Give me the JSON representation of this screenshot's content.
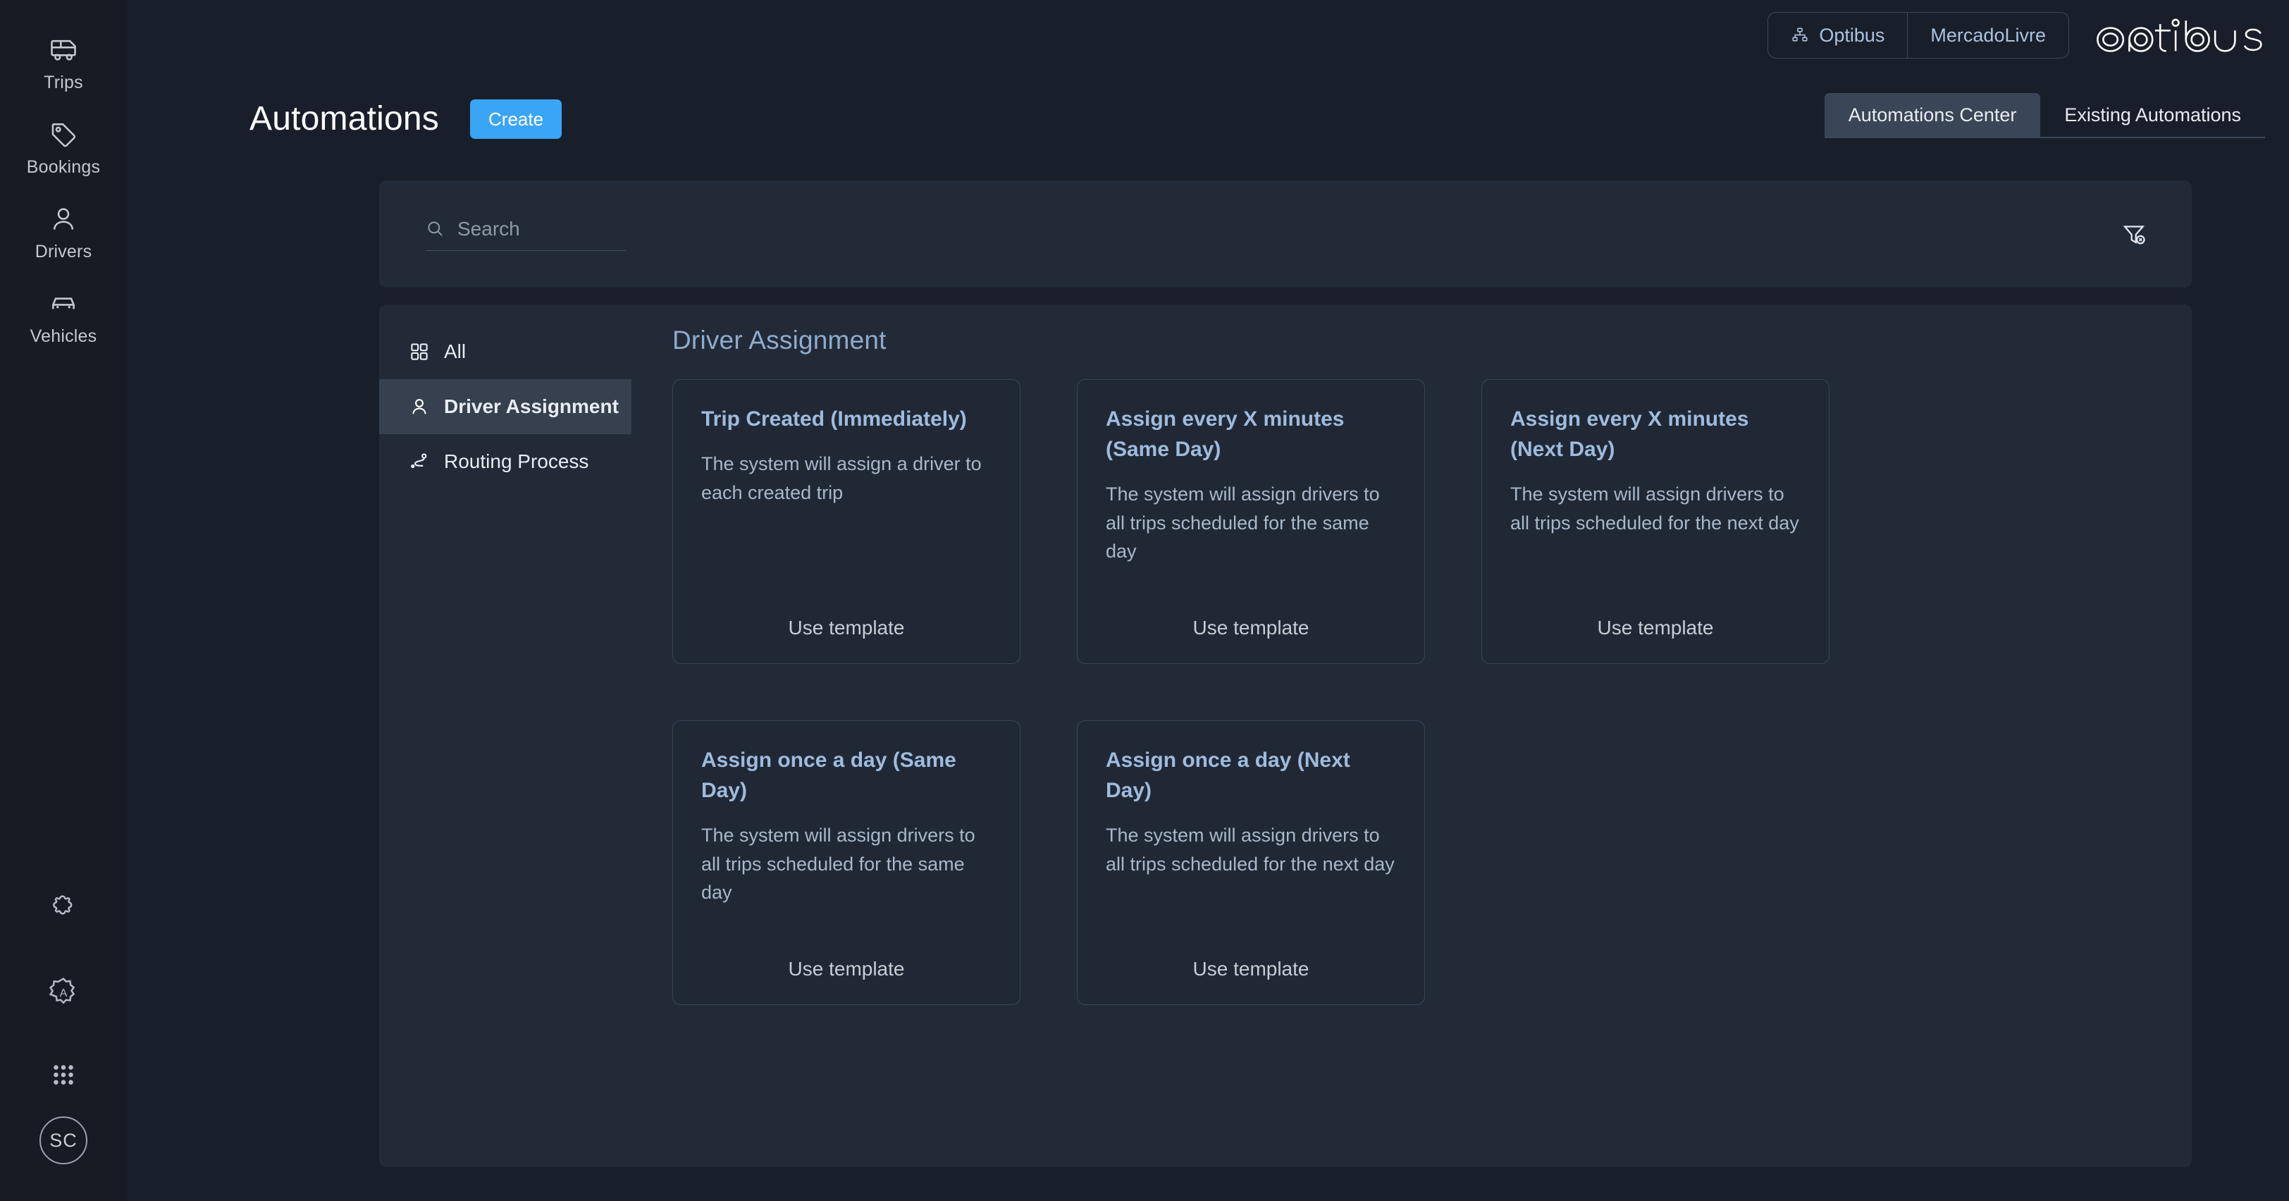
{
  "sidebar": {
    "nav_items": [
      {
        "label": "Trips",
        "icon": "bus-icon"
      },
      {
        "label": "Bookings",
        "icon": "tag-icon"
      },
      {
        "label": "Drivers",
        "icon": "person-icon"
      },
      {
        "label": "Vehicles",
        "icon": "car-icon"
      }
    ],
    "utilities": [
      {
        "icon": "puzzle-icon"
      },
      {
        "icon": "automations-badge-icon"
      },
      {
        "icon": "apps-grid-icon"
      }
    ],
    "avatar_initials": "SC"
  },
  "header": {
    "org_switcher": {
      "current": "Optibus",
      "tenant": "MercadoLivre"
    },
    "logo_text": "optibus"
  },
  "page": {
    "title": "Automations",
    "create_label": "Create",
    "tabs": [
      {
        "label": "Automations Center",
        "active": true
      },
      {
        "label": "Existing Automations",
        "active": false
      }
    ]
  },
  "search": {
    "placeholder": "Search",
    "value": ""
  },
  "categories": [
    {
      "label": "All",
      "icon": "grid-icon",
      "active": false
    },
    {
      "label": "Driver Assignment",
      "icon": "person-icon",
      "active": true
    },
    {
      "label": "Routing Process",
      "icon": "route-icon",
      "active": false
    }
  ],
  "section": {
    "title": "Driver Assignment"
  },
  "templates": [
    {
      "title": "Trip Created (Immediately)",
      "description": "The system will assign a driver to each created trip",
      "action": "Use template"
    },
    {
      "title": "Assign every X minutes (Same Day)",
      "description": "The system will assign drivers to all trips scheduled for the same day",
      "action": "Use template"
    },
    {
      "title": "Assign every X minutes (Next Day)",
      "description": "The system will assign drivers to all trips scheduled for the next day",
      "action": "Use template"
    },
    {
      "title": "Assign once a day (Same Day)",
      "description": "The system will assign drivers to all trips scheduled for the same day",
      "action": "Use template"
    },
    {
      "title": "Assign once a day (Next Day)",
      "description": "The system will assign drivers to all trips scheduled for the next day",
      "action": "Use template"
    }
  ],
  "colors": {
    "page_background": "#191f2a",
    "sidebar_background": "#161b24",
    "panel_background": "#222a38",
    "accent_blue": "#3ba5f5",
    "card_title": "#9fbbdc",
    "active_tab": "#3a4557",
    "selected_category": "#36404f"
  }
}
